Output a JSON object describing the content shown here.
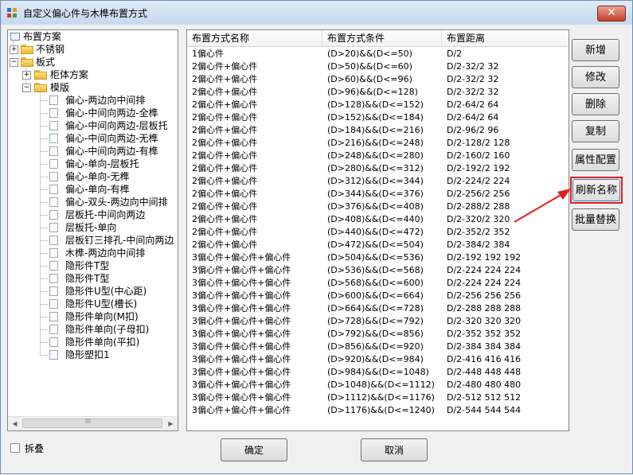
{
  "window": {
    "title": "自定义偏心件与木榫布置方式",
    "close_label": "✕"
  },
  "tree": {
    "root": "布置方案",
    "items": [
      "不锈钢",
      "板式",
      "柜体方案",
      "模版"
    ],
    "leaves": [
      "偏心-两边向中间排",
      "偏心-中间向两边-全榫",
      "偏心-中间向两边-层板托",
      "偏心-中间向两边-无榫",
      "偏心-中间向两边-有榫",
      "偏心-单向-层板托",
      "偏心-单向-无榫",
      "偏心-单向-有榫",
      "偏心-双头-两边向中间排",
      "层板托-中间向两边",
      "层板托-单向",
      "层板钉三排孔-中间向两边",
      "木榫-两边向中间排",
      "隐形件T型",
      "隐形件T型",
      "隐形件U型(中心距)",
      "隐形件U型(槽长)",
      "隐形件单向(M扣)",
      "隐形件单向(子母扣)",
      "隐形件单向(平扣)",
      "隐形塑扣1"
    ],
    "scroll_grip": "III"
  },
  "grid": {
    "headers": [
      "布置方式名称",
      "布置方式条件",
      "布置距离"
    ],
    "rows": [
      [
        "1偏心件",
        "(D>20)&&(D<=50)",
        "D/2"
      ],
      [
        "2偏心件+偏心件",
        "(D>50)&&(D<=60)",
        "D/2-32/2 32"
      ],
      [
        "2偏心件+偏心件",
        "(D>60)&&(D<=96)",
        "D/2-32/2 32"
      ],
      [
        "2偏心件+偏心件",
        "(D>96)&&(D<=128)",
        "D/2-32/2 32"
      ],
      [
        "2偏心件+偏心件",
        "(D>128)&&(D<=152)",
        "D/2-64/2 64"
      ],
      [
        "2偏心件+偏心件",
        "(D>152)&&(D<=184)",
        "D/2-64/2 64"
      ],
      [
        "2偏心件+偏心件",
        "(D>184)&&(D<=216)",
        "D/2-96/2 96"
      ],
      [
        "2偏心件+偏心件",
        "(D>216)&&(D<=248)",
        "D/2-128/2 128"
      ],
      [
        "2偏心件+偏心件",
        "(D>248)&&(D<=280)",
        "D/2-160/2 160"
      ],
      [
        "2偏心件+偏心件",
        "(D>280)&&(D<=312)",
        "D/2-192/2 192"
      ],
      [
        "2偏心件+偏心件",
        "(D>312)&&(D<=344)",
        "D/2-224/2 224"
      ],
      [
        "2偏心件+偏心件",
        "(D>344)&&(D<=376)",
        "D/2-256/2 256"
      ],
      [
        "2偏心件+偏心件",
        "(D>376)&&(D<=408)",
        "D/2-288/2 288"
      ],
      [
        "2偏心件+偏心件",
        "(D>408)&&(D<=440)",
        "D/2-320/2 320"
      ],
      [
        "2偏心件+偏心件",
        "(D>440)&&(D<=472)",
        "D/2-352/2 352"
      ],
      [
        "2偏心件+偏心件",
        "(D>472)&&(D<=504)",
        "D/2-384/2 384"
      ],
      [
        "3偏心件+偏心件+偏心件",
        "(D>504)&&(D<=536)",
        "D/2-192 192 192"
      ],
      [
        "3偏心件+偏心件+偏心件",
        "(D>536)&&(D<=568)",
        "D/2-224 224 224"
      ],
      [
        "3偏心件+偏心件+偏心件",
        "(D>568)&&(D<=600)",
        "D/2-224 224 224"
      ],
      [
        "3偏心件+偏心件+偏心件",
        "(D>600)&&(D<=664)",
        "D/2-256 256 256"
      ],
      [
        "3偏心件+偏心件+偏心件",
        "(D>664)&&(D<=728)",
        "D/2-288 288 288"
      ],
      [
        "3偏心件+偏心件+偏心件",
        "(D>728)&&(D<=792)",
        "D/2-320 320 320"
      ],
      [
        "3偏心件+偏心件+偏心件",
        "(D>792)&&(D<=856)",
        "D/2-352 352 352"
      ],
      [
        "3偏心件+偏心件+偏心件",
        "(D>856)&&(D<=920)",
        "D/2-384 384 384"
      ],
      [
        "3偏心件+偏心件+偏心件",
        "(D>920)&&(D<=984)",
        "D/2-416 416 416"
      ],
      [
        "3偏心件+偏心件+偏心件",
        "(D>984)&&(D<=1048)",
        "D/2-448 448 448"
      ],
      [
        "3偏心件+偏心件+偏心件",
        "(D>1048)&&(D<=1112)",
        "D/2-480 480 480"
      ],
      [
        "3偏心件+偏心件+偏心件",
        "(D>1112)&&(D<=1176)",
        "D/2-512 512 512"
      ],
      [
        "3偏心件+偏心件+偏心件",
        "(D>1176)&&(D<=1240)",
        "D/2-544 544 544"
      ]
    ]
  },
  "buttons": {
    "add": "新增",
    "edit": "修改",
    "delete": "删除",
    "copy": "复制",
    "properties": "属性配置",
    "refresh": "刷新名称",
    "batch_replace": "批量替换"
  },
  "footer": {
    "fold_label": "拆叠",
    "ok": "确定",
    "cancel": "取消"
  },
  "colors": {
    "highlight": "#e02020"
  }
}
